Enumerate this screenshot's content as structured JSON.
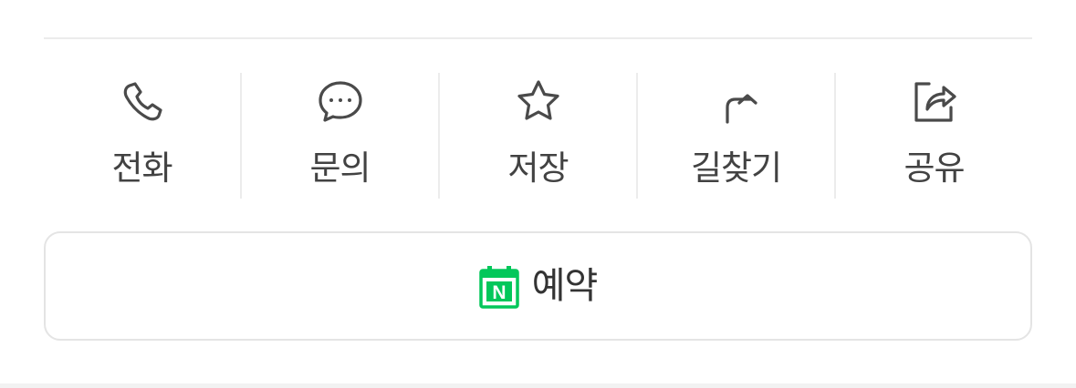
{
  "actions": [
    {
      "id": "call",
      "label": "전화",
      "icon": "phone-icon"
    },
    {
      "id": "inquiry",
      "label": "문의",
      "icon": "chat-bubble-icon"
    },
    {
      "id": "save",
      "label": "저장",
      "icon": "star-icon"
    },
    {
      "id": "directions",
      "label": "길찾기",
      "icon": "route-arrow-icon"
    },
    {
      "id": "share",
      "label": "공유",
      "icon": "share-icon"
    }
  ],
  "reservation": {
    "label": "예약",
    "icon": "naver-booking-calendar-icon",
    "icon_letter": "N",
    "icon_color": "#03c75a"
  },
  "colors": {
    "icon_stroke": "#4a4a4a",
    "text": "#424242",
    "divider": "#ececec",
    "brand_green": "#03c75a"
  }
}
